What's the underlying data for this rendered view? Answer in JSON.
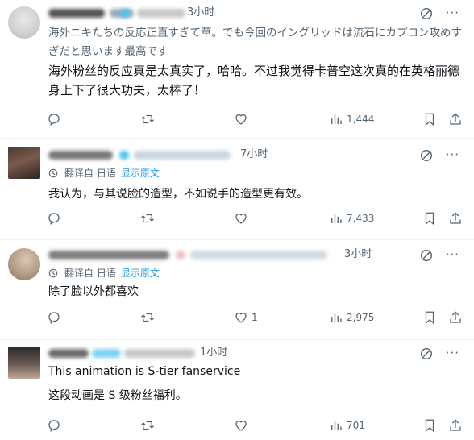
{
  "posts": [
    {
      "time": "3小时",
      "text_original": "海外ニキたちの反応正直すぎて草。でも今回のイングリッドは流石にカプコン攻めすぎだと思います最高です",
      "text_translated": "海外粉丝的反应真是太真实了，哈哈。不过我觉得卡普空这次真的在英格丽德身上下了很大功夫，太棒了！",
      "views": "1,444"
    },
    {
      "time": "7小时",
      "translated_from": "翻译自 日语",
      "show_original": "显示原文",
      "text": "我认为，与其说脸的造型，不如说手的造型更有效。",
      "views": "7,433"
    },
    {
      "time": "3小时",
      "translated_from": "翻译自 日语",
      "show_original": "显示原文",
      "text": "除了脸以外都喜欢",
      "likes": "1",
      "views": "2,975"
    },
    {
      "time": "1小时",
      "text_original": "This animation is S-tier fanservice",
      "text_translated": "这段动画是 S 级粉丝福利。",
      "views": "701"
    }
  ],
  "icons": {
    "reply": "reply-icon",
    "retweet": "retweet-icon",
    "like": "like-icon",
    "views": "views-icon",
    "bookmark": "bookmark-icon",
    "share": "share-icon",
    "grok": "grok-icon",
    "more": "more-icon",
    "translate": "translate-icon"
  },
  "colors": {
    "text": "#0f1419",
    "secondary": "#536471",
    "link": "#1d9bf0",
    "divider": "#eff3f4"
  }
}
